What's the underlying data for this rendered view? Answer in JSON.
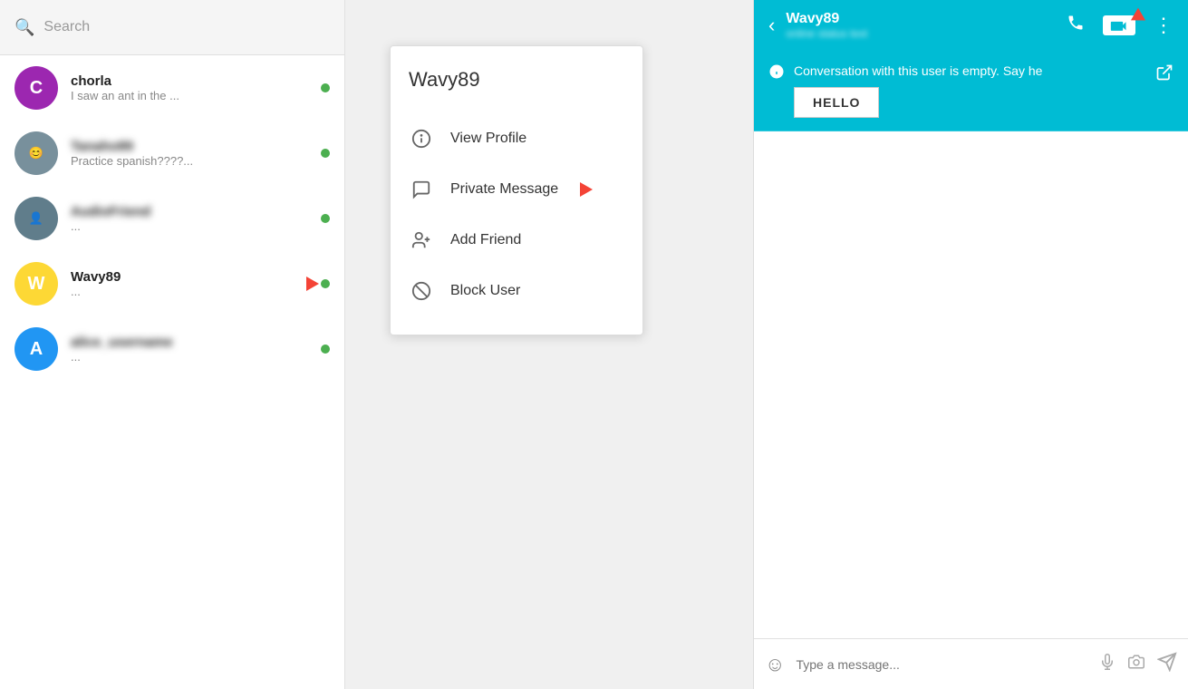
{
  "sidebar": {
    "search_placeholder": "Search",
    "contacts": [
      {
        "id": "chorla",
        "name": "chorla",
        "preview": "I saw an ant in the ...",
        "avatar_letter": "C",
        "avatar_color": "avatar-c",
        "online": true,
        "blurred": false,
        "has_image": false
      },
      {
        "id": "tanaho89",
        "name": "Tanaho89",
        "preview": "Practice spanish????...",
        "avatar_letter": "",
        "avatar_color": "",
        "online": true,
        "blurred": true,
        "has_image": true,
        "image_placeholder": "avatar2"
      },
      {
        "id": "audiofriend",
        "name": "AudioFriend",
        "preview": "...",
        "avatar_letter": "",
        "avatar_color": "",
        "online": true,
        "blurred": true,
        "has_image": true,
        "image_placeholder": "avatar3"
      },
      {
        "id": "wavy89",
        "name": "Wavy89",
        "preview": "...",
        "avatar_letter": "W",
        "avatar_color": "avatar-w",
        "online": true,
        "blurred": false,
        "has_image": false,
        "has_cursor": true
      },
      {
        "id": "alice",
        "name": "alice_username",
        "preview": "...",
        "avatar_letter": "A",
        "avatar_color": "avatar-a",
        "online": true,
        "blurred": true,
        "has_image": false
      }
    ]
  },
  "context_menu": {
    "title": "Wavy89",
    "items": [
      {
        "id": "view-profile",
        "label": "View Profile",
        "icon": "ℹ️"
      },
      {
        "id": "private-message",
        "label": "Private Message",
        "icon": "💬"
      },
      {
        "id": "add-friend",
        "label": "Add Friend",
        "icon": "👤+"
      },
      {
        "id": "block-user",
        "label": "Block User",
        "icon": "🚫"
      }
    ]
  },
  "chat": {
    "header": {
      "name": "Wavy89",
      "status": "online status text"
    },
    "notification": {
      "text": "Conversation with this user is empty. Say he",
      "hello_label": "HELLO"
    },
    "input": {
      "placeholder": "Type a message..."
    }
  }
}
